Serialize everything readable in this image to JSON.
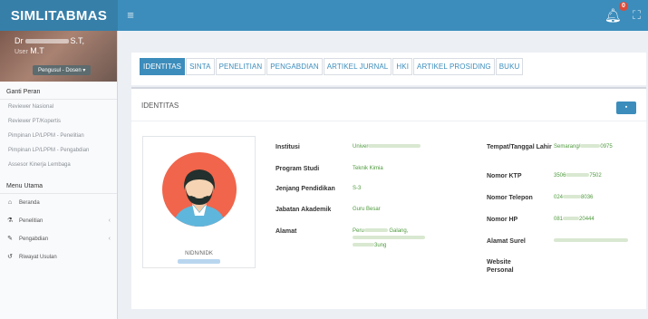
{
  "app": {
    "title": "SIMLITABMAS",
    "notification_count": "0"
  },
  "user": {
    "name_suffix": "S.T,",
    "name_line2": "M.T",
    "role_prefix": "User",
    "role_button": "Pengusul - Dosen"
  },
  "sidebar": {
    "ganti_peran_header": "Ganti Peran",
    "roles": [
      "Reviewer Nasional",
      "Reviewer PT/Kopertis",
      "Pimpinan LP/LPPM - Penelitian",
      "Pimpinan LP/LPPM - Pengabdian",
      "Assesor Kinerja Lembaga"
    ],
    "menu_header": "Menu Utama",
    "menu": [
      {
        "label": "Beranda",
        "icon": "home-icon"
      },
      {
        "label": "Penelitian",
        "icon": "flask-icon"
      },
      {
        "label": "Pengabdian",
        "icon": "pencil-icon"
      },
      {
        "label": "Riwayat Usulan",
        "icon": "history-icon"
      }
    ]
  },
  "tabs": [
    "IDENTITAS",
    "SINTA",
    "PENELITIAN",
    "PENGABDIAN",
    "ARTIKEL JURNAL",
    "HKI",
    "ARTIKEL PROSIDING",
    "BUKU"
  ],
  "active_tab": "IDENTITAS",
  "panel": {
    "title": "IDENTITAS",
    "button_icon": "edit-icon"
  },
  "profile": {
    "nidn_label": "NIDN/NIDK",
    "left_fields": [
      {
        "label": "Institusi",
        "value": "Univer"
      },
      {
        "label": "Program Studi",
        "value": "Teknik Kimia"
      },
      {
        "label": "Jenjang Pendidikan",
        "value": "S-3"
      },
      {
        "label": "Jabatan Akademik",
        "value": "Guru Besar"
      },
      {
        "label": "Alamat",
        "value": "Peru"
      }
    ],
    "right_fields": [
      {
        "label": "Tempat/Tanggal Lahir",
        "value": "Semarang/"
      },
      {
        "label": "Nomor KTP",
        "value": "3506"
      },
      {
        "label": "Nomor Telepon",
        "value": "024"
      },
      {
        "label": "Nomor HP",
        "value": "081"
      },
      {
        "label": "Alamat Surel",
        "value": ""
      },
      {
        "label": "Website Personal",
        "value": ""
      }
    ],
    "ktp_tail": "7502",
    "telp_tail": "8036",
    "hp_tail": "20444",
    "lahir_tail": "0975",
    "alamat_mid": "Galang,",
    "alamat_end": "3ung"
  },
  "colors": {
    "primary": "#3c8dbc",
    "header_dark": "#367fa9",
    "avatar_bg": "#f0654b"
  }
}
